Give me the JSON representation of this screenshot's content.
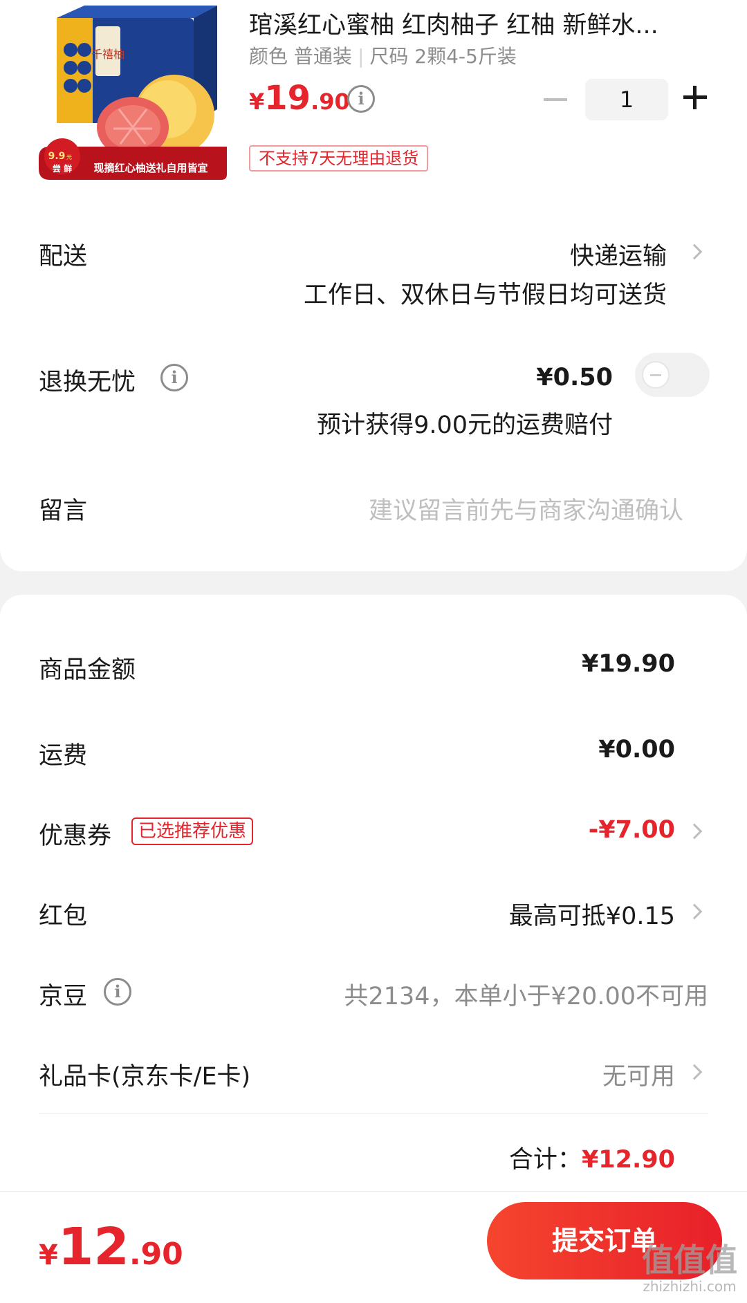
{
  "product": {
    "title": "琯溪红心蜜柚 红肉柚子 红柚 新鲜水...",
    "spec_color_label": "颜色",
    "spec_color_value": "普通装",
    "spec_size_label": "尺码",
    "spec_size_value": "2颗4-5斤装",
    "price_yen": "¥",
    "price_int": "19",
    "price_dec": ".90",
    "quantity": "1",
    "return_tag": "不支持7天无理由退货",
    "image": {
      "brand_text": "千禧柚",
      "badge_price": "9.9",
      "badge_price_unit": "元",
      "badge_label": "尝 鲜",
      "badge_text": "现摘红心柚送礼自用皆宜"
    }
  },
  "delivery": {
    "label": "配送",
    "value": "快递运输",
    "sub": "工作日、双休日与节假日均可送货"
  },
  "return_worry_free": {
    "label": "退换无忧",
    "price": "¥0.50",
    "sub": "预计获得9.00元的运费赔付",
    "enabled": false
  },
  "message": {
    "label": "留言",
    "placeholder": "建议留言前先与商家沟通确认"
  },
  "summary": {
    "goods_label": "商品金额",
    "goods_value": "¥19.90",
    "shipping_label": "运费",
    "shipping_value": "¥0.00",
    "coupon_label": "优惠券",
    "coupon_tag": "已选推荐优惠",
    "coupon_value": "-¥7.00",
    "redpacket_label": "红包",
    "redpacket_value": "最高可抵¥0.15",
    "jingdou_label": "京豆",
    "jingdou_value": "共2134，本单小于¥20.00不可用",
    "giftcard_label": "礼品卡(京东卡/E卡)",
    "giftcard_value": "无可用",
    "total_label": "合计：",
    "total_value": "¥12.90"
  },
  "bottom": {
    "price_yen": "¥",
    "price_int": "12",
    "price_dec": ".90",
    "submit_label": "提交订单"
  },
  "watermark": {
    "big": "值值值",
    "small": "zhizhizhi.com"
  },
  "colors": {
    "accent_red": "#e5242b",
    "background": "#f2f2f2"
  }
}
